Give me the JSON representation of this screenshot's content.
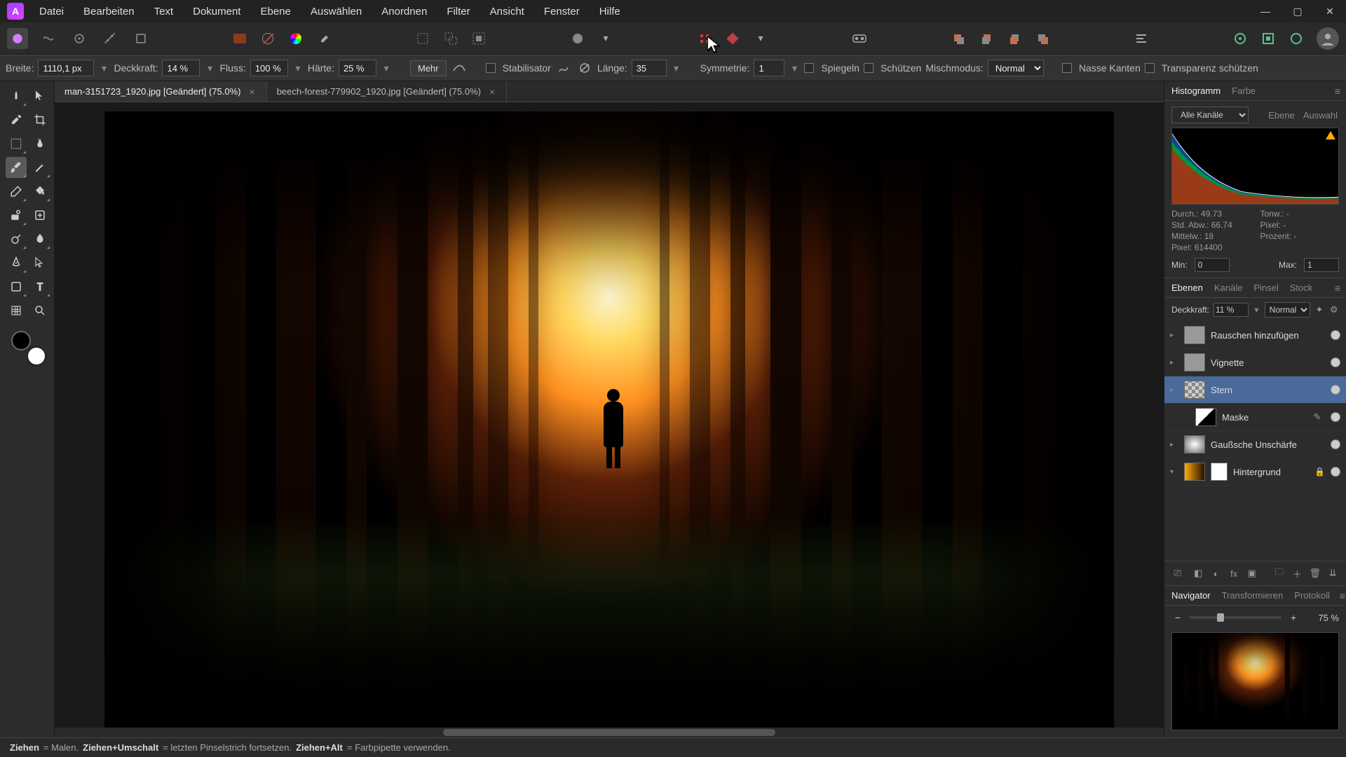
{
  "menu": [
    "Datei",
    "Bearbeiten",
    "Text",
    "Dokument",
    "Ebene",
    "Auswählen",
    "Anordnen",
    "Filter",
    "Ansicht",
    "Fenster",
    "Hilfe"
  ],
  "context_bar": {
    "width_label": "Breite:",
    "width_value": "1110,1 px",
    "opacity_label": "Deckkraft:",
    "opacity_value": "14 %",
    "flow_label": "Fluss:",
    "flow_value": "100 %",
    "hardness_label": "Härte:",
    "hardness_value": "25 %",
    "more": "Mehr",
    "stabilizer": "Stabilisator",
    "length_label": "Länge:",
    "length_value": "35",
    "symmetry_label": "Symmetrie:",
    "symmetry_value": "1",
    "mirror": "Spiegeln",
    "protect": "Schützen",
    "blend_label": "Mischmodus:",
    "blend_value": "Normal",
    "wet_edges": "Nasse Kanten",
    "protect_alpha": "Transparenz schützen"
  },
  "documents": [
    {
      "title": "man-3151723_1920.jpg [Geändert] (75.0%)",
      "active": true
    },
    {
      "title": "beech-forest-779902_1920.jpg [Geändert] (75.0%)",
      "active": false
    }
  ],
  "histogram": {
    "tabs": [
      "Histogramm",
      "Farbe"
    ],
    "channel": "Alle Kanäle",
    "side_tabs": [
      "Ebene",
      "Auswahl"
    ],
    "stats": {
      "mean_label": "Durch.:",
      "mean": "49.73",
      "std_label": "Std. Abw.:",
      "std": "66.74",
      "median_label": "Mittelw.:",
      "median": "18",
      "pixels_label": "Pixel:",
      "pixels": "614400",
      "tone_label": "Tonw.:",
      "tone": "-",
      "pix_label": "Pixel:",
      "pix": "-",
      "perc_label": "Prozent:",
      "perc": "-"
    },
    "min_label": "Min:",
    "min": "0",
    "max_label": "Max:",
    "max": "1"
  },
  "layers_panel": {
    "tabs": [
      "Ebenen",
      "Kanäle",
      "Pinsel",
      "Stock"
    ],
    "opacity_label": "Deckkraft:",
    "opacity_value": "11 %",
    "blend": "Normal",
    "layers": [
      {
        "name": "Rauschen hinzufügen",
        "selected": false,
        "visible": true,
        "thumb": "#888"
      },
      {
        "name": "Vignette",
        "selected": false,
        "visible": true,
        "thumb": "#888"
      },
      {
        "name": "Stern",
        "selected": true,
        "visible": true,
        "thumb": "checker"
      },
      {
        "name": "Maske",
        "selected": false,
        "visible": true,
        "thumb": "mask",
        "child": true,
        "edit": true
      },
      {
        "name": "Gaußsche Unschärfe",
        "selected": false,
        "visible": true,
        "thumb": "#888"
      },
      {
        "name": "Hintergrund",
        "selected": false,
        "visible": true,
        "thumb": "forest",
        "lock": true,
        "masked": true
      }
    ]
  },
  "navigator": {
    "tabs": [
      "Navigator",
      "Transformieren",
      "Protokoll"
    ],
    "zoom": "75 %"
  },
  "status": {
    "s1": "Ziehen",
    "e1": " = Malen. ",
    "s2": "Ziehen+Umschalt",
    "e2": " = letzten Pinselstrich fortsetzen. ",
    "s3": "Ziehen+Alt",
    "e3": " = Farbpipette verwenden."
  }
}
